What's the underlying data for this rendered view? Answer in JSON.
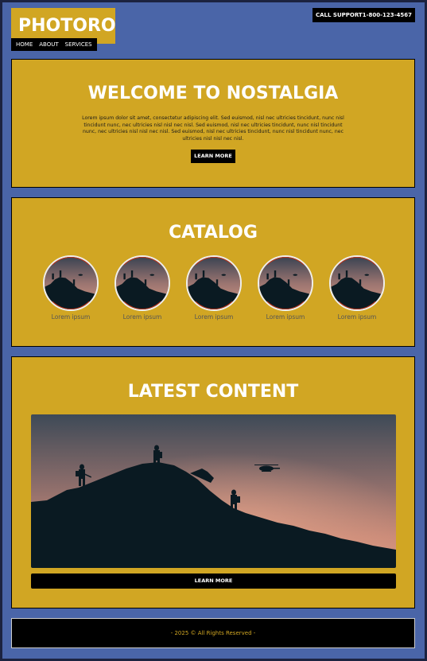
{
  "header": {
    "logo": "PHOTORO",
    "nav": [
      "HOME",
      "ABOUT",
      "SERVICES"
    ],
    "call_support": "CALL SUPPORT1-800-123-4567"
  },
  "welcome": {
    "title": "WELCOME TO NOSTALGIA",
    "text": "Lorem ipsum dolor sit amet, consectetur adipiscing elit. Sed euismod, nisl nec ultricies tincidunt, nunc nisl tincidunt nunc, nec ultricies nisl nisl nec nisl. Sed euismod, nisl nec ultricies tincidunt, nunc nisl tincidunt nunc, nec ultricies nisl nisl nec nisl. Sed euismod, nisl nec ultricies tincidunt, nunc nisl tincidunt nunc, nec ultricies nisl nisl nec nisl.",
    "button": "LEARN MORE"
  },
  "catalog": {
    "title": "CATALOG",
    "items": [
      {
        "label": "Lorem ipsum"
      },
      {
        "label": "Lorem ipsum"
      },
      {
        "label": "Lorem ipsum"
      },
      {
        "label": "Lorem ipsum"
      },
      {
        "label": "Lorem ipsum"
      }
    ]
  },
  "latest": {
    "title": "LATEST CONTENT",
    "button": "LEARN MORE"
  },
  "footer": {
    "text": "- 2025 © All Rights Reserved -"
  },
  "colors": {
    "page_background": "#4a65a8",
    "section_background": "#d1a623",
    "button_background": "#000000",
    "footer_text": "#d1a623"
  }
}
